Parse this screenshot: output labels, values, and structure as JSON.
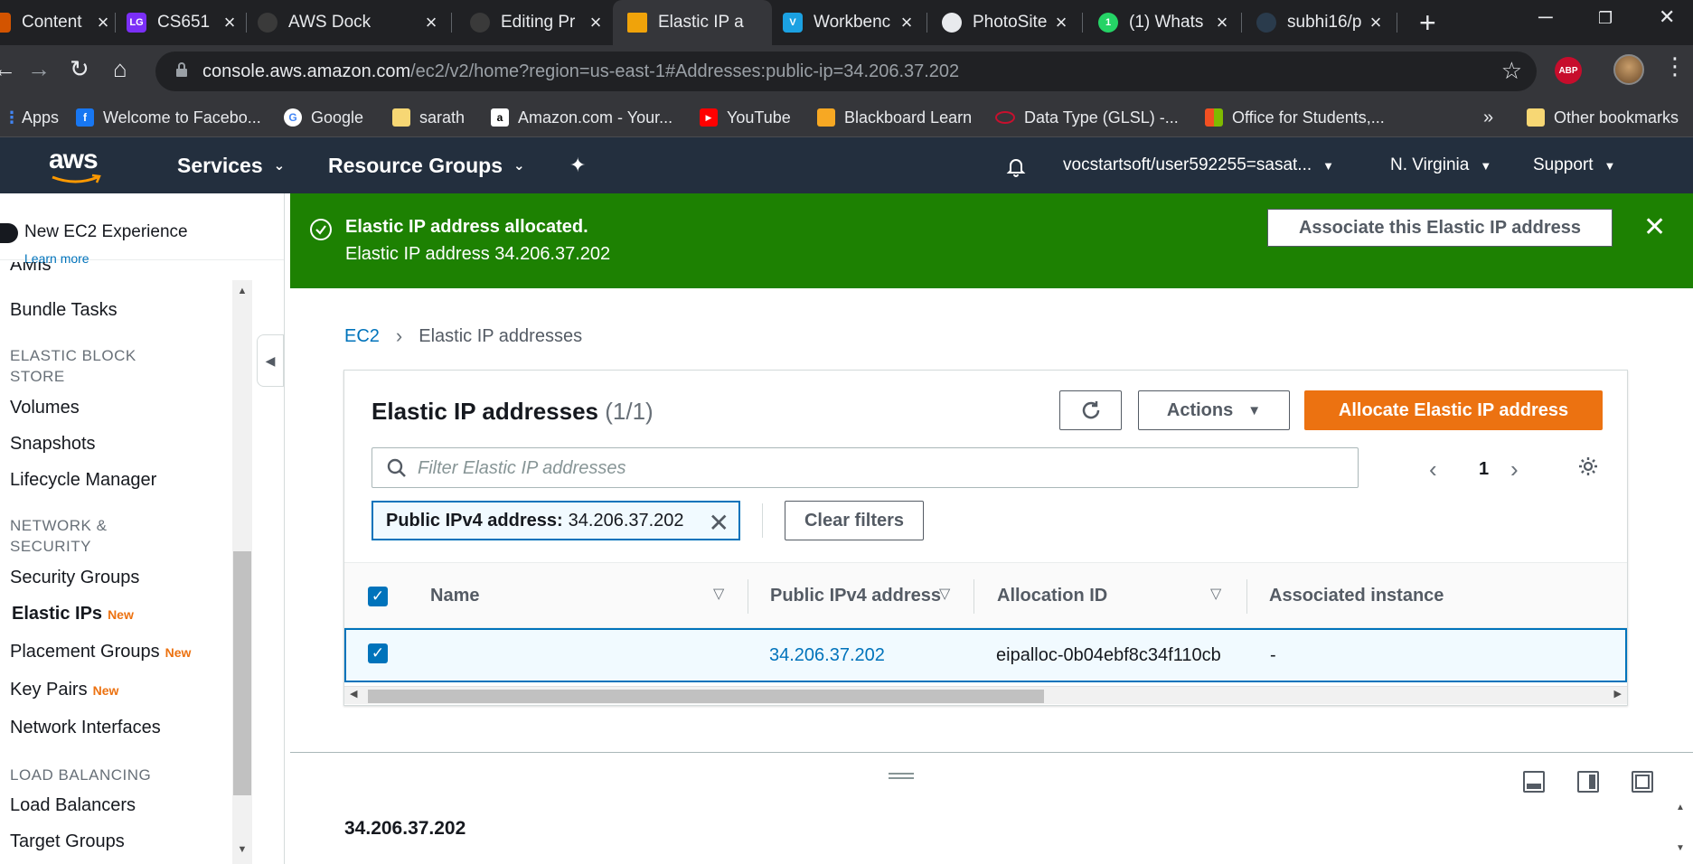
{
  "browser": {
    "tabs": [
      {
        "title": "Content",
        "favicon": "content-icon",
        "color": "#d35400"
      },
      {
        "title": "CS651",
        "favicon": "lg-icon",
        "color": "#7b2ff7"
      },
      {
        "title": "AWS Dock",
        "favicon": "github-icon",
        "color": "#3a3a3a"
      },
      {
        "title": "Editing Pr",
        "favicon": "github-icon",
        "color": "#3a3a3a"
      },
      {
        "title": "Elastic IP a",
        "favicon": "aws-box-icon",
        "color": "#f0a30a"
      },
      {
        "title": "Workbenc",
        "favicon": "v-icon",
        "color": "#1ba1e2"
      },
      {
        "title": "PhotoSite",
        "favicon": "globe-icon",
        "color": "#e8eaed"
      },
      {
        "title": "(1) Whats",
        "favicon": "whatsapp-icon",
        "color": "#25d366"
      },
      {
        "title": "subhi16/p",
        "favicon": "docker-icon",
        "color": "#2a3b4c"
      }
    ],
    "new_tab_label": "+",
    "url_host": "console.aws.amazon.com",
    "url_path": "/ec2/v2/home?region=us-east-1#Addresses:public-ip=34.206.37.202",
    "abp_label": "ABP",
    "bookmarks": [
      {
        "label": "Apps",
        "icon": "apps-grid-icon",
        "color": "#4285f4"
      },
      {
        "label": "Welcome to Facebo...",
        "icon": "facebook-icon",
        "color": "#1877f2"
      },
      {
        "label": "Google",
        "icon": "google-icon",
        "color": "#ffffff"
      },
      {
        "label": "sarath",
        "icon": "folder-icon",
        "color": "#f7d774"
      },
      {
        "label": "Amazon.com - Your...",
        "icon": "amazon-icon",
        "color": "#ffffff"
      },
      {
        "label": "YouTube",
        "icon": "youtube-icon",
        "color": "#ff0000"
      },
      {
        "label": "Blackboard Learn",
        "icon": "blackboard-icon",
        "color": "#f7a823"
      },
      {
        "label": "Data Type (GLSL) -...",
        "icon": "opengl-icon",
        "color": "#c8102e"
      },
      {
        "label": "Office for Students,...",
        "icon": "microsoft-icon",
        "color": "#f25022"
      }
    ],
    "bookmarks_overflow": "»",
    "other_bookmarks": "Other bookmarks"
  },
  "aws_header": {
    "logo": "aws",
    "services": "Services",
    "resource_groups": "Resource Groups",
    "account": "vocstartsoft/user592255=sasat...",
    "region": "N. Virginia",
    "support": "Support"
  },
  "sidebar": {
    "toggle_label": "New EC2 Experience",
    "learn_more": "Learn more",
    "partial_top": "AMIs",
    "items": [
      {
        "label": "Bundle Tasks",
        "new": ""
      },
      {
        "heading": "ELASTIC BLOCK STORE"
      },
      {
        "label": "Volumes",
        "new": ""
      },
      {
        "label": "Snapshots",
        "new": ""
      },
      {
        "label": "Lifecycle Manager",
        "new": ""
      },
      {
        "heading": "NETWORK & SECURITY"
      },
      {
        "label": "Security Groups",
        "new": ""
      },
      {
        "label": "Elastic IPs",
        "new": "New",
        "active": true
      },
      {
        "label": "Placement Groups",
        "new": "New"
      },
      {
        "label": "Key Pairs",
        "new": "New"
      },
      {
        "label": "Network Interfaces",
        "new": ""
      },
      {
        "heading": "LOAD BALANCING"
      },
      {
        "label": "Load Balancers",
        "new": ""
      },
      {
        "label": "Target Groups",
        "new": ""
      }
    ]
  },
  "flash": {
    "title": "Elastic IP address allocated.",
    "message": "Elastic IP address 34.206.37.202",
    "action": "Associate this Elastic IP address",
    "color": "#1d8102"
  },
  "breadcrumb": {
    "root": "EC2",
    "current": "Elastic IP addresses"
  },
  "panel": {
    "title": "Elastic IP addresses",
    "count": "(1/1)",
    "actions_label": "Actions",
    "allocate_label": "Allocate Elastic IP address",
    "search_placeholder": "Filter Elastic IP addresses",
    "page": "1",
    "filter_token_key": "Public IPv4 address:",
    "filter_token_value": "34.206.37.202",
    "clear_filters": "Clear filters",
    "columns": [
      "Name",
      "Public IPv4 address",
      "Allocation ID",
      "Associated instance"
    ],
    "rows": [
      {
        "selected": true,
        "name": "",
        "public_ip": "34.206.37.202",
        "allocation_id": "eipalloc-0b04ebf8c34f110cb",
        "instance": "-"
      }
    ],
    "accent": "#ec7211",
    "link_color": "#0073bb"
  },
  "split_panel": {
    "title": "34.206.37.202"
  }
}
